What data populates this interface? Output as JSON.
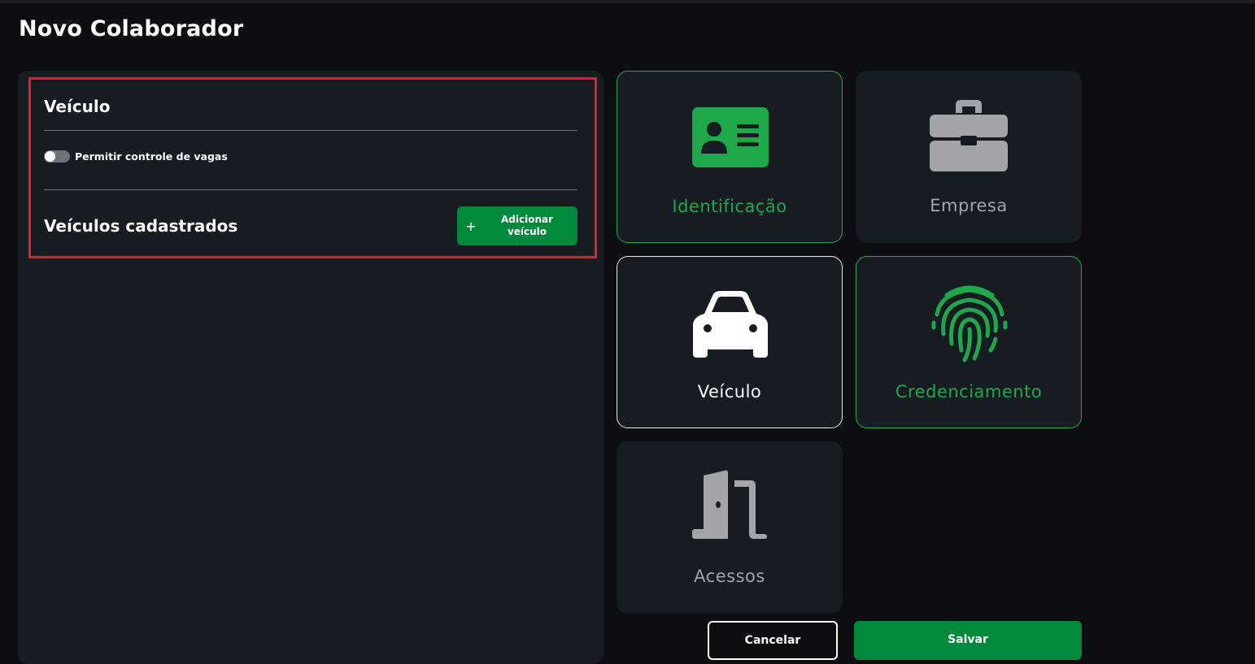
{
  "page": {
    "title": "Novo Colaborador"
  },
  "vehicle_section": {
    "title": "Veículo",
    "toggle_label": "Permitir controle de vagas",
    "toggle_on": false,
    "registered_title": "Veículos cadastrados",
    "add_button": {
      "icon": "+",
      "label": "Adicionar veículo"
    }
  },
  "cards": [
    {
      "label": "Identificação",
      "icon": "id-card-icon",
      "state": "completed",
      "color": "#1ea84a"
    },
    {
      "label": "Empresa",
      "icon": "briefcase-icon",
      "state": "inactive",
      "color": "#a2a4a8"
    },
    {
      "label": "Veículo",
      "icon": "car-icon",
      "state": "selected",
      "color": "#ffffff"
    },
    {
      "label": "Credenciamento",
      "icon": "fingerprint-icon",
      "state": "completed",
      "color": "#1ea84a"
    },
    {
      "label": "Acessos",
      "icon": "door-icon",
      "state": "inactive",
      "color": "#a2a4a8"
    }
  ],
  "actions": {
    "cancel": "Cancelar",
    "save": "Salvar"
  },
  "colors": {
    "accent": "#00893d",
    "highlight": "#e0202a",
    "panel": "#171b22",
    "background": "#0c0e11"
  }
}
